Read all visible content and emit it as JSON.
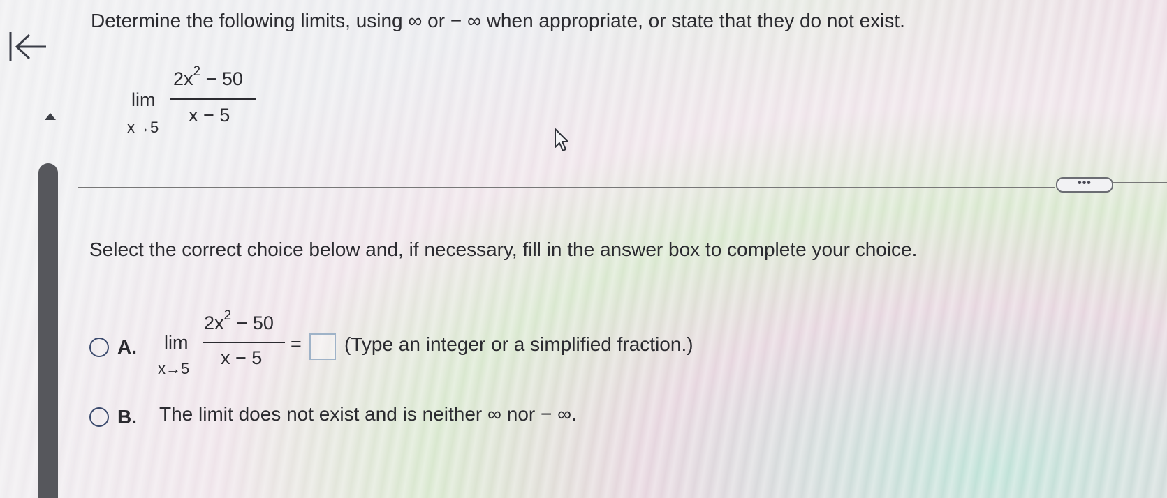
{
  "nav": {
    "back_icon": "back-to-start-arrow-icon"
  },
  "question": {
    "instruction": "Determine the following limits, using ∞ or − ∞ when appropriate, or state that they do not exist.",
    "limit": {
      "lim": "lim",
      "sub": "x→5",
      "numerator": "2x",
      "numerator_exp": "2",
      "numerator_rest": " − 50",
      "denominator": "x − 5"
    }
  },
  "more_button": {
    "label": "•••"
  },
  "prompt": "Select the correct choice below and, if necessary, fill in the answer box to complete your choice.",
  "choices": {
    "a": {
      "letter": "A.",
      "lim": "lim",
      "sub": "x→5",
      "numerator": "2x",
      "numerator_exp": "2",
      "numerator_rest": " − 50",
      "denominator": "x − 5",
      "equals": "=",
      "answer_value": "",
      "hint": "(Type an integer or a simplified fraction.)"
    },
    "b": {
      "letter": "B.",
      "text": "The limit does not exist and is neither ∞ nor − ∞."
    }
  }
}
